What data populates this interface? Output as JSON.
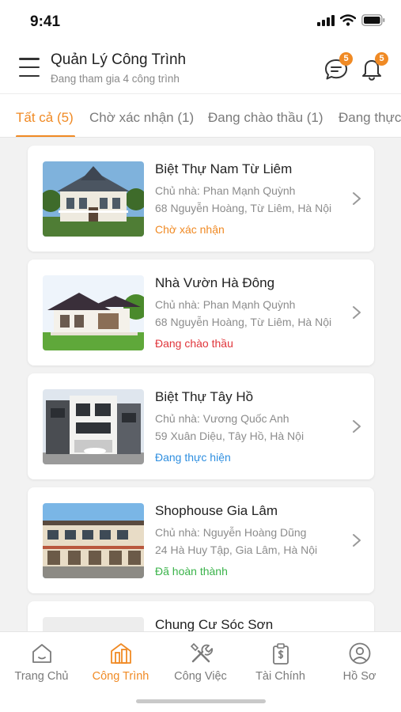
{
  "status_bar": {
    "time": "9:41"
  },
  "header": {
    "title": "Quản Lý Công Trình",
    "subtitle": "Đang tham gia 4 công trình",
    "chat_badge": "5",
    "notification_badge": "5"
  },
  "tabs": [
    {
      "label": "Tất cả (5)",
      "active": true
    },
    {
      "label": "Chờ xác nhận (1)",
      "active": false
    },
    {
      "label": "Đang chào thầu (1)",
      "active": false
    },
    {
      "label": "Đang thực",
      "active": false
    }
  ],
  "projects": [
    {
      "name": "Biệt Thự Nam Từ Liêm",
      "owner": "Chủ nhà: Phan Mạnh Quỳnh",
      "address": "68 Nguyễn Hoàng, Từ Liêm, Hà Nội",
      "status": "Chờ xác nhận",
      "status_color": "#f08a24"
    },
    {
      "name": "Nhà Vườn Hà Đông",
      "owner": "Chủ nhà: Phan Mạnh Quỳnh",
      "address": "68 Nguyễn Hoàng, Từ Liêm, Hà Nội",
      "status": "Đang chào thầu",
      "status_color": "#e0353b"
    },
    {
      "name": "Biệt Thự Tây Hồ",
      "owner": "Chủ nhà: Vương Quốc Anh",
      "address": "59 Xuân Diệu, Tây Hồ, Hà Nội",
      "status": "Đang thực hiện",
      "status_color": "#2f8fe0"
    },
    {
      "name": "Shophouse Gia Lâm",
      "owner": "Chủ nhà: Nguyễn Hoàng Dũng",
      "address": "24 Hà Huy Tập, Gia Lâm, Hà Nội",
      "status": "Đã hoàn thành",
      "status_color": "#3ab34a"
    },
    {
      "name": "Chung Cư Sóc Sơn"
    }
  ],
  "bottom_nav": [
    {
      "label": "Trang Chủ",
      "icon": "home-icon",
      "active": false
    },
    {
      "label": "Công Trình",
      "icon": "building-icon",
      "active": true
    },
    {
      "label": "Công Việc",
      "icon": "tools-icon",
      "active": false
    },
    {
      "label": "Tài Chính",
      "icon": "finance-icon",
      "active": false
    },
    {
      "label": "Hồ Sơ",
      "icon": "profile-icon",
      "active": false
    }
  ],
  "colors": {
    "accent": "#f08a24",
    "inactive": "#7a7a7a"
  }
}
